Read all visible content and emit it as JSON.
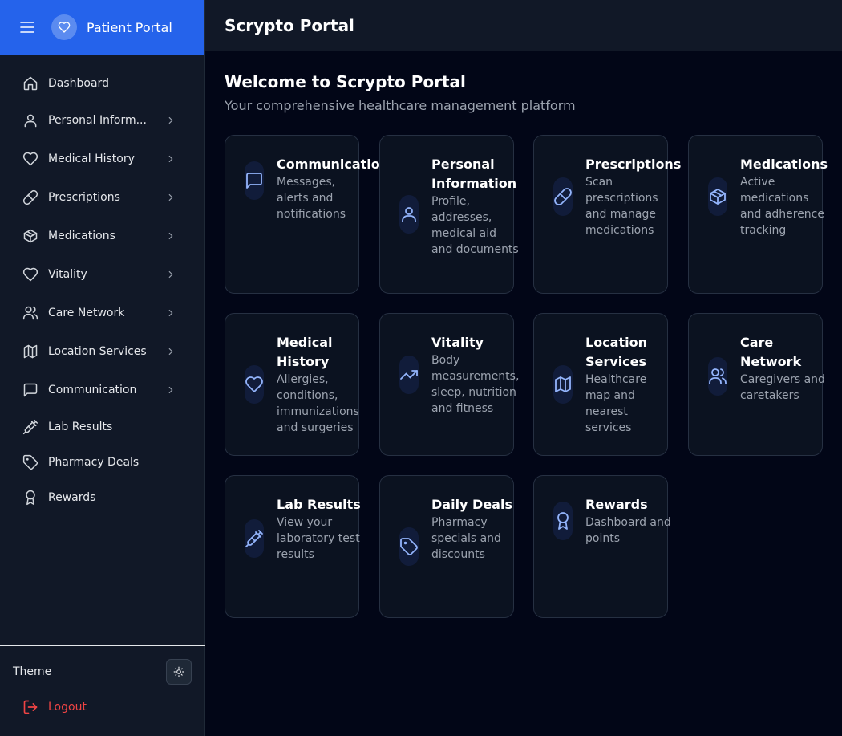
{
  "sidebar": {
    "brand": "Patient Portal",
    "items": [
      {
        "label": "Dashboard",
        "icon": "home-icon",
        "chevron": false
      },
      {
        "label": "Personal Inform...",
        "icon": "user-icon",
        "chevron": true
      },
      {
        "label": "Medical History",
        "icon": "heart-icon",
        "chevron": true
      },
      {
        "label": "Prescriptions",
        "icon": "pill-icon",
        "chevron": true
      },
      {
        "label": "Medications",
        "icon": "package-icon",
        "chevron": true
      },
      {
        "label": "Vitality",
        "icon": "heart-icon",
        "chevron": true
      },
      {
        "label": "Care Network",
        "icon": "users-icon",
        "chevron": true
      },
      {
        "label": "Location Services",
        "icon": "map-icon",
        "chevron": true
      },
      {
        "label": "Communication",
        "icon": "message-icon",
        "chevron": true
      },
      {
        "label": "Lab Results",
        "icon": "syringe-icon",
        "chevron": false
      },
      {
        "label": "Pharmacy Deals",
        "icon": "tag-icon",
        "chevron": false
      },
      {
        "label": "Rewards",
        "icon": "award-icon",
        "chevron": false
      }
    ],
    "theme_label": "Theme",
    "logout_label": "Logout"
  },
  "header": {
    "title": "Scrypto Portal"
  },
  "main": {
    "welcome": "Welcome to Scrypto Portal",
    "subtitle": "Your comprehensive healthcare management platform",
    "cards": [
      {
        "title": "Communications",
        "description": "Messages, alerts and notifications",
        "icon": "message-icon"
      },
      {
        "title": "Personal Information",
        "description": "Profile, addresses, medical aid and documents",
        "icon": "user-icon"
      },
      {
        "title": "Prescriptions",
        "description": "Scan prescriptions and manage medications",
        "icon": "pill-icon"
      },
      {
        "title": "Medications",
        "description": "Active medications and adherence tracking",
        "icon": "package-icon"
      },
      {
        "title": "Medical History",
        "description": "Allergies, conditions, immunizations and surgeries",
        "icon": "heart-icon"
      },
      {
        "title": "Vitality",
        "description": "Body measurements, sleep, nutrition and fitness",
        "icon": "trending-up-icon"
      },
      {
        "title": "Location Services",
        "description": "Healthcare map and nearest services",
        "icon": "map-icon"
      },
      {
        "title": "Care Network",
        "description": "Caregivers and caretakers",
        "icon": "users-icon"
      },
      {
        "title": "Lab Results",
        "description": "View your laboratory test results",
        "icon": "syringe-icon"
      },
      {
        "title": "Daily Deals",
        "description": "Pharmacy specials and discounts",
        "icon": "tag-icon"
      },
      {
        "title": "Rewards",
        "description": "Dashboard and points",
        "icon": "award-icon"
      }
    ]
  },
  "colors": {
    "accent": "#2563eb",
    "background": "#020617",
    "sidebar": "#111827",
    "card": "#0b1220",
    "icon_blue": "#93b4fb",
    "logout_red": "#ef4444"
  }
}
